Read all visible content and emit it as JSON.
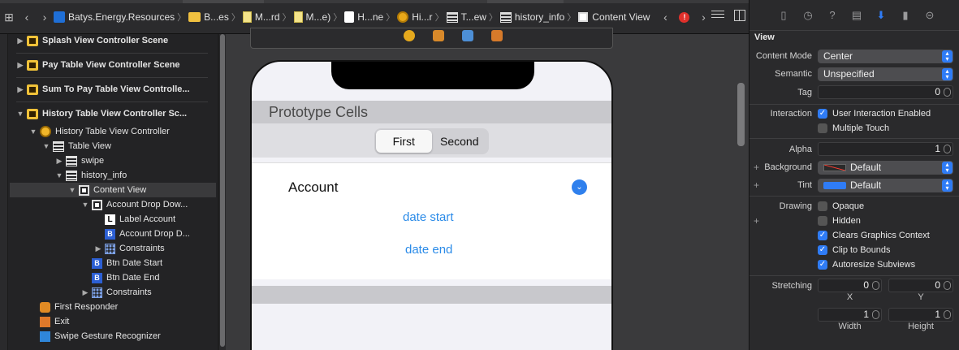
{
  "colors": {
    "accent": "#2f7cf6",
    "link": "#2b8be8",
    "error": "#e0302b"
  },
  "jumpbar": {
    "crumbs": [
      "Batys.Energy.Resources",
      "B...es",
      "M...rd",
      "M...e)",
      "H...ne",
      "Hi...r",
      "T...ew",
      "history_info",
      "Content View"
    ],
    "error_badge": "!"
  },
  "outline": {
    "scenes": [
      "Splash View Controller Scene",
      "Pay Table View Controller Scene",
      "Sum To Pay Table View Controlle...",
      "History Table View Controller Sc..."
    ],
    "tree": [
      "History Table View Controller",
      "Table View",
      "swipe",
      "history_info",
      "Content View",
      "Account Drop Dow...",
      "Label Account",
      "Account Drop D...",
      "Constraints",
      "Btn Date Start",
      "Btn Date End",
      "Constraints",
      "First Responder",
      "Exit",
      "Swipe Gesture Recognizer"
    ]
  },
  "canvas": {
    "section_header": "Prototype Cells",
    "segments": [
      "First",
      "Second"
    ],
    "account_label": "Account",
    "date_start": "date start",
    "date_end": "date end"
  },
  "inspector": {
    "section": "View",
    "content_mode_label": "Content Mode",
    "content_mode_value": "Center",
    "semantic_label": "Semantic",
    "semantic_value": "Unspecified",
    "tag_label": "Tag",
    "tag_value": "0",
    "interaction_label": "Interaction",
    "user_interaction": "User Interaction Enabled",
    "multiple_touch": "Multiple Touch",
    "alpha_label": "Alpha",
    "alpha_value": "1",
    "background_label": "Background",
    "background_value": "Default",
    "tint_label": "Tint",
    "tint_value": "Default",
    "drawing_label": "Drawing",
    "opaque": "Opaque",
    "hidden": "Hidden",
    "clears_graphics": "Clears Graphics Context",
    "clip_to_bounds": "Clip to Bounds",
    "autoresize": "Autoresize Subviews",
    "stretching_label": "Stretching",
    "stretch_x": "0",
    "stretch_y": "0",
    "x_label": "X",
    "y_label": "Y",
    "stretch_w": "1",
    "stretch_h": "1",
    "width_label": "Width",
    "height_label": "Height",
    "plus_sign": "+"
  }
}
